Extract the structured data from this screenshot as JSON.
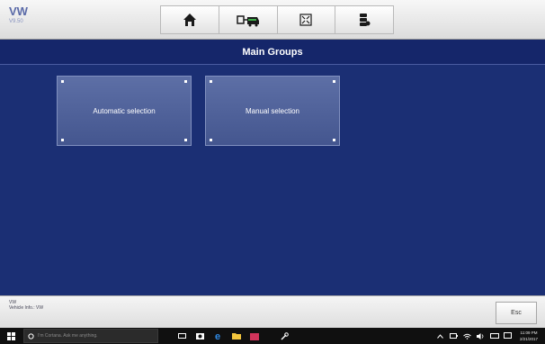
{
  "header": {
    "brand": "VW",
    "brand_sub": "V9.50"
  },
  "page": {
    "title": "Main Groups"
  },
  "groups": [
    {
      "label": "Automatic selection"
    },
    {
      "label": "Manual selection"
    }
  ],
  "footer": {
    "vehicle_name": "VW",
    "vehicle_info": "Vehicle Info.: VW",
    "esc_label": "Esc"
  },
  "taskbar": {
    "search_placeholder": "I'm Cortana. Ask me anything.",
    "time": "11:09 PM",
    "date": "2/21/2017"
  },
  "colors": {
    "background": "#1b2f74",
    "title_bar": "#15266a",
    "tile": "#5d6fa6"
  }
}
